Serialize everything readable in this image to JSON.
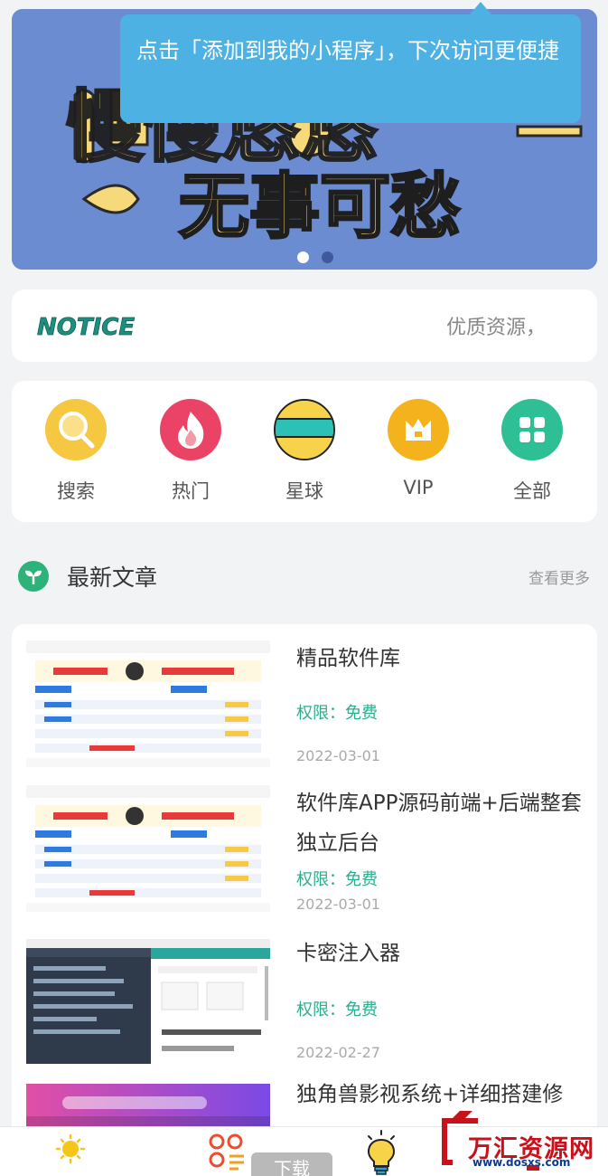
{
  "banner": {
    "art_text_top": "慢慢悠悠",
    "art_text_bottom": "无事可愁",
    "slide_count": 2,
    "active_slide": 1
  },
  "tooltip": {
    "text": "点击「添加到我的小程序」，下次访问更便捷"
  },
  "notice": {
    "logo_text": "NOTICE",
    "marquee": "优质资源，"
  },
  "menu": {
    "items": [
      {
        "label": "搜索",
        "icon": "search-icon",
        "color": "#f6c741"
      },
      {
        "label": "热门",
        "icon": "flame-icon",
        "color": "#ea4366"
      },
      {
        "label": "星球",
        "icon": "planet-icon",
        "color": "#f6d34a"
      },
      {
        "label": "VIP",
        "icon": "crown-icon",
        "color": "#f4b21c"
      },
      {
        "label": "全部",
        "icon": "grid-icon",
        "color": "#2fbf94"
      }
    ]
  },
  "section": {
    "icon": "sprout-icon",
    "title": "最新文章",
    "more": "查看更多"
  },
  "articles": [
    {
      "title": "精品软件库",
      "permission": "权限：免费",
      "date": "2022-03-01",
      "thumb": "app-light"
    },
    {
      "title": "软件库APP源码前端+后端整套独立后台",
      "permission": "权限：免费",
      "date": "2022-03-01",
      "thumb": "app-light"
    },
    {
      "title": "卡密注入器",
      "permission": "权限：免费",
      "date": "2022-02-27",
      "thumb": "admin-dark"
    },
    {
      "title": "独角兽影视系统+详细搭建修",
      "permission": "",
      "date": "",
      "thumb": "video-purple"
    }
  ],
  "bottom_nav": {
    "items": [
      {
        "icon": "sun-icon"
      },
      {
        "icon": "apps-icon"
      },
      {
        "icon": "bulb-icon"
      }
    ],
    "download_label": "下载"
  },
  "watermark": {
    "text": "万汇资源网",
    "url": "www.dosxs.com"
  }
}
